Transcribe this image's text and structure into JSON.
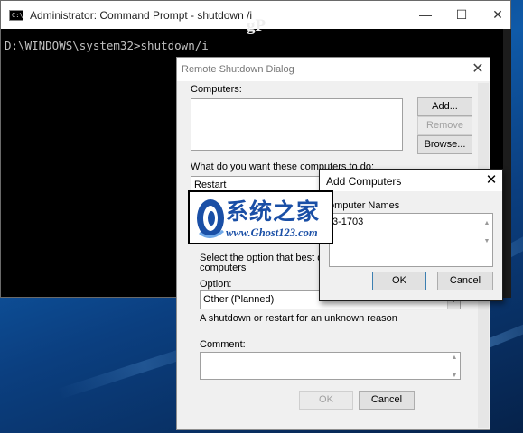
{
  "cmd": {
    "title": "Administrator: Command Prompt - shutdown /i",
    "console_line": "D:\\WINDOWS\\system32>shutdown/i",
    "controls": {
      "minimize": "—",
      "maximize": "☐",
      "close": "✕"
    }
  },
  "remote_shutdown": {
    "title": "Remote Shutdown Dialog",
    "close": "✕",
    "computers_label": "Computers:",
    "add_button": "Add...",
    "remove_button": "Remove",
    "browse_button": "Browse...",
    "action_label": "What do you want these computers to do:",
    "action_value": "Restart",
    "reason_text_1": "Select the option that best descri",
    "reason_text_2": "computers",
    "option_label": "Option:",
    "option_value": "Other (Planned)",
    "option_description": "A shutdown or restart for an unknown reason",
    "comment_label": "Comment:",
    "ok_button": "OK",
    "cancel_button": "Cancel"
  },
  "add_computers": {
    "title": "Add Computers",
    "close": "✕",
    "names_label": "omputer Names",
    "names_value": "3-1703",
    "ok_button": "OK",
    "cancel_button": "Cancel"
  },
  "watermark": {
    "logo": "ghost-logo-icon",
    "chinese_text": "系统之家",
    "url": "www.Ghost123.com"
  },
  "overlay_logo": {
    "text": "gP"
  },
  "colors": {
    "desktop": "#0f5aa8",
    "console_bg": "#000000",
    "console_text": "#c0c0c0",
    "watermark_blue": "#1a4fa6"
  }
}
